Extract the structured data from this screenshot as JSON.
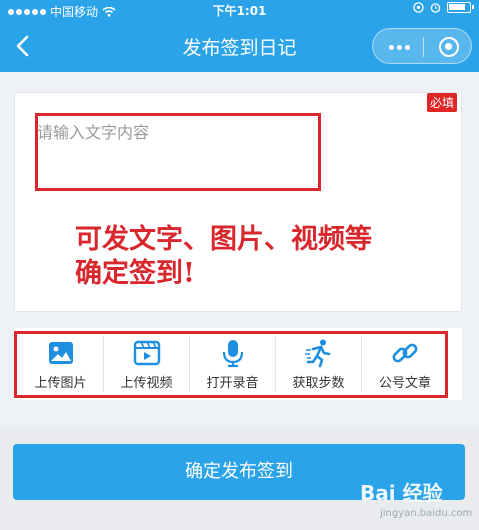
{
  "status_bar": {
    "carrier": "中国移动",
    "time": "下午1:01"
  },
  "navbar": {
    "title": "发布签到日记"
  },
  "editor": {
    "placeholder": "请输入文字内容",
    "required_badge": "必填"
  },
  "annotation": {
    "line1": "可发文字、图片、视频等",
    "line2": "确定签到!"
  },
  "tools": [
    {
      "label": "上传图片",
      "icon": "image-icon"
    },
    {
      "label": "上传视频",
      "icon": "video-icon"
    },
    {
      "label": "打开录音",
      "icon": "microphone-icon"
    },
    {
      "label": "获取步数",
      "icon": "running-icon"
    },
    {
      "label": "公号文章",
      "icon": "link-icon"
    }
  ],
  "submit": {
    "label": "确定发布签到"
  },
  "watermark": {
    "text": "Bai 经验",
    "sub": "jingyan.baidu.com"
  },
  "colors": {
    "primary": "#2aa3e8",
    "annotation_red": "#d9272e"
  }
}
